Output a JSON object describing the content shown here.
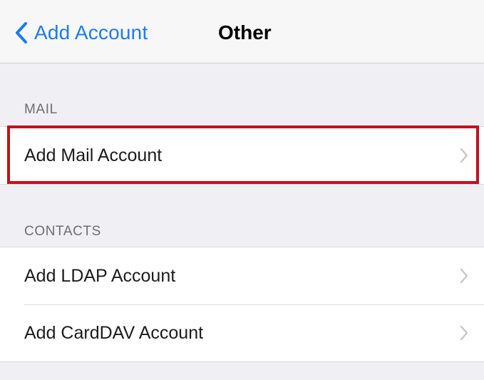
{
  "nav": {
    "back_label": "Add Account",
    "title": "Other"
  },
  "sections": {
    "mail": {
      "header": "MAIL",
      "rows": [
        "Add Mail Account"
      ]
    },
    "contacts": {
      "header": "CONTACTS",
      "rows": [
        "Add LDAP Account",
        "Add CardDAV Account"
      ]
    }
  },
  "colors": {
    "accent": "#1a7cf5",
    "highlight": "#c1121c",
    "background": "#efeff4"
  }
}
